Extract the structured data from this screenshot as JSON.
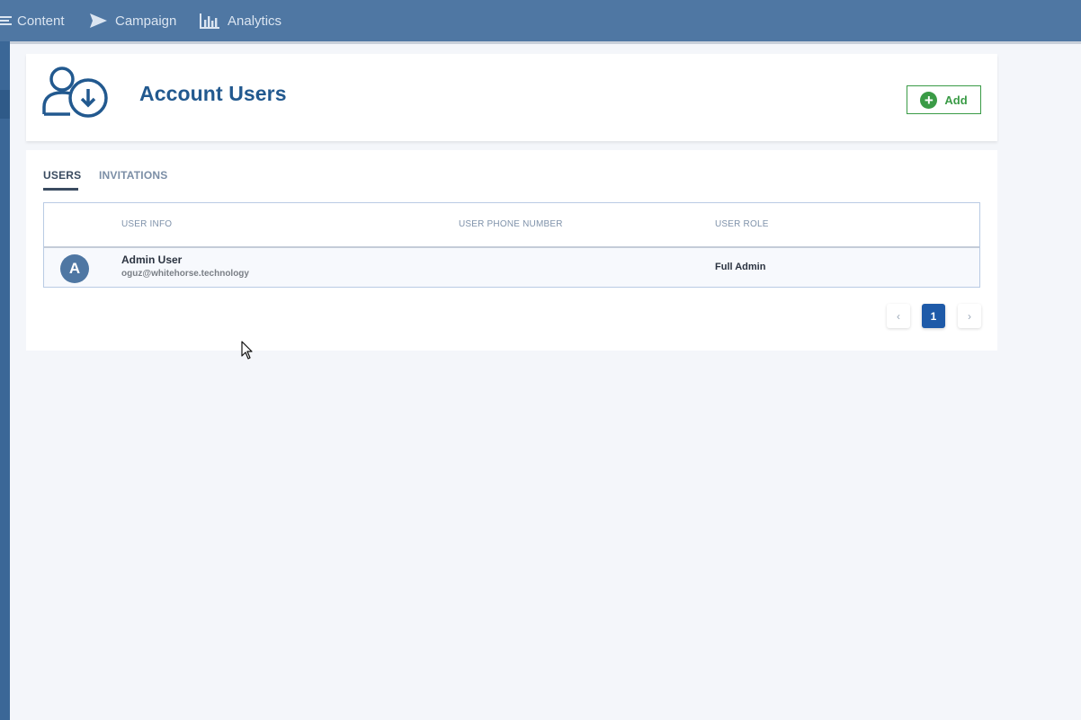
{
  "topnav": {
    "items": [
      {
        "label": "Content",
        "icon": "menu-lines-icon"
      },
      {
        "label": "Campaign",
        "icon": "send-icon"
      },
      {
        "label": "Analytics",
        "icon": "bar-chart-icon"
      }
    ]
  },
  "header": {
    "title": "Account Users",
    "icon": "user-download-icon",
    "add_label": "Add"
  },
  "tabs": [
    {
      "label": "USERS",
      "active": true
    },
    {
      "label": "INVITATIONS",
      "active": false
    }
  ],
  "table": {
    "columns": [
      "USER INFO",
      "USER PHONE NUMBER",
      "USER ROLE"
    ],
    "rows": [
      {
        "avatar": "A",
        "name": "Admin User",
        "email": "oguz@whitehorse.technology",
        "phone": "",
        "role": "Full Admin"
      }
    ]
  },
  "pagination": {
    "prev": "‹",
    "current": "1",
    "next": "›"
  },
  "colors": {
    "nav": "#4f77a3",
    "primary": "#22598f",
    "success": "#3a9b46",
    "active_page": "#1e5aa8"
  }
}
